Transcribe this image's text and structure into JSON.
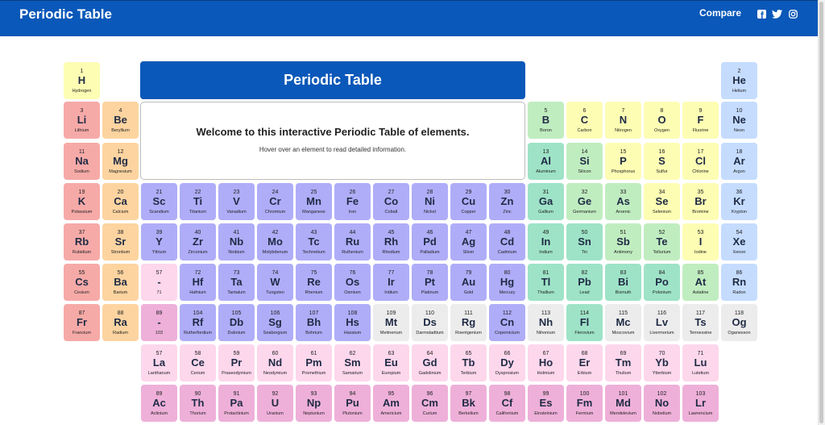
{
  "header": {
    "title": "Periodic Table",
    "compare_label": "Compare",
    "social": [
      "facebook-icon",
      "twitter-icon",
      "instagram-icon"
    ]
  },
  "banner": {
    "title": "Periodic Table"
  },
  "info": {
    "welcome": "Welcome to this interactive Periodic Table of elements.",
    "hint": "Hover over an element to read detailed information."
  },
  "colors": {
    "header_bg": "#0a58b9",
    "alkali": "#f6aaa8",
    "alkaline": "#fdd4a0",
    "transition": "#afadf8",
    "lanthanide": "#fdd7ec",
    "actinide": "#eeb0d9",
    "post_transition": "#9ee3c7",
    "metalloid": "#c0edc0",
    "nonmetal": "#fdfdb4",
    "noble": "#c5dcff",
    "hydrogen": "#fdfdb4",
    "unknown": "#ececec"
  },
  "elements": [
    {
      "n": "1",
      "s": "H",
      "name": "Hydrogen",
      "cat": "hydrogen",
      "r": 0,
      "c": 0
    },
    {
      "n": "2",
      "s": "He",
      "name": "Helium",
      "cat": "noble",
      "r": 0,
      "c": 17
    },
    {
      "n": "3",
      "s": "Li",
      "name": "Lithium",
      "cat": "alkali",
      "r": 1,
      "c": 0
    },
    {
      "n": "4",
      "s": "Be",
      "name": "Beryllium",
      "cat": "alkaline",
      "r": 1,
      "c": 1
    },
    {
      "n": "5",
      "s": "B",
      "name": "Boron",
      "cat": "metalloid",
      "r": 1,
      "c": 12
    },
    {
      "n": "6",
      "s": "C",
      "name": "Carbon",
      "cat": "nonmetal",
      "r": 1,
      "c": 13
    },
    {
      "n": "7",
      "s": "N",
      "name": "Nitrogen",
      "cat": "nonmetal",
      "r": 1,
      "c": 14
    },
    {
      "n": "8",
      "s": "O",
      "name": "Oxygen",
      "cat": "nonmetal",
      "r": 1,
      "c": 15
    },
    {
      "n": "9",
      "s": "F",
      "name": "Fluorine",
      "cat": "nonmetal",
      "r": 1,
      "c": 16
    },
    {
      "n": "10",
      "s": "Ne",
      "name": "Neon",
      "cat": "noble",
      "r": 1,
      "c": 17
    },
    {
      "n": "11",
      "s": "Na",
      "name": "Sodium",
      "cat": "alkali",
      "r": 2,
      "c": 0
    },
    {
      "n": "12",
      "s": "Mg",
      "name": "Magnesium",
      "cat": "alkaline",
      "r": 2,
      "c": 1
    },
    {
      "n": "13",
      "s": "Al",
      "name": "Aluminum",
      "cat": "post_transition",
      "r": 2,
      "c": 12
    },
    {
      "n": "14",
      "s": "Si",
      "name": "Silicon",
      "cat": "metalloid",
      "r": 2,
      "c": 13
    },
    {
      "n": "15",
      "s": "P",
      "name": "Phosphorus",
      "cat": "nonmetal",
      "r": 2,
      "c": 14
    },
    {
      "n": "16",
      "s": "S",
      "name": "Sulfur",
      "cat": "nonmetal",
      "r": 2,
      "c": 15
    },
    {
      "n": "17",
      "s": "Cl",
      "name": "Chlorine",
      "cat": "nonmetal",
      "r": 2,
      "c": 16
    },
    {
      "n": "18",
      "s": "Ar",
      "name": "Argon",
      "cat": "noble",
      "r": 2,
      "c": 17
    },
    {
      "n": "19",
      "s": "K",
      "name": "Potassium",
      "cat": "alkali",
      "r": 3,
      "c": 0
    },
    {
      "n": "20",
      "s": "Ca",
      "name": "Calcium",
      "cat": "alkaline",
      "r": 3,
      "c": 1
    },
    {
      "n": "21",
      "s": "Sc",
      "name": "Scandium",
      "cat": "transition",
      "r": 3,
      "c": 2
    },
    {
      "n": "22",
      "s": "Ti",
      "name": "Titanium",
      "cat": "transition",
      "r": 3,
      "c": 3
    },
    {
      "n": "23",
      "s": "V",
      "name": "Vanadium",
      "cat": "transition",
      "r": 3,
      "c": 4
    },
    {
      "n": "24",
      "s": "Cr",
      "name": "Chromium",
      "cat": "transition",
      "r": 3,
      "c": 5
    },
    {
      "n": "25",
      "s": "Mn",
      "name": "Manganese",
      "cat": "transition",
      "r": 3,
      "c": 6
    },
    {
      "n": "26",
      "s": "Fe",
      "name": "Iron",
      "cat": "transition",
      "r": 3,
      "c": 7
    },
    {
      "n": "27",
      "s": "Co",
      "name": "Cobalt",
      "cat": "transition",
      "r": 3,
      "c": 8
    },
    {
      "n": "28",
      "s": "Ni",
      "name": "Nickel",
      "cat": "transition",
      "r": 3,
      "c": 9
    },
    {
      "n": "29",
      "s": "Cu",
      "name": "Copper",
      "cat": "transition",
      "r": 3,
      "c": 10
    },
    {
      "n": "30",
      "s": "Zn",
      "name": "Zinc",
      "cat": "transition",
      "r": 3,
      "c": 11
    },
    {
      "n": "31",
      "s": "Ga",
      "name": "Gallium",
      "cat": "post_transition",
      "r": 3,
      "c": 12
    },
    {
      "n": "32",
      "s": "Ge",
      "name": "Germanium",
      "cat": "metalloid",
      "r": 3,
      "c": 13
    },
    {
      "n": "33",
      "s": "As",
      "name": "Arsenic",
      "cat": "metalloid",
      "r": 3,
      "c": 14
    },
    {
      "n": "34",
      "s": "Se",
      "name": "Selenium",
      "cat": "nonmetal",
      "r": 3,
      "c": 15
    },
    {
      "n": "35",
      "s": "Br",
      "name": "Bromine",
      "cat": "nonmetal",
      "r": 3,
      "c": 16
    },
    {
      "n": "36",
      "s": "Kr",
      "name": "Krypton",
      "cat": "noble",
      "r": 3,
      "c": 17
    },
    {
      "n": "37",
      "s": "Rb",
      "name": "Rubidium",
      "cat": "alkali",
      "r": 4,
      "c": 0
    },
    {
      "n": "38",
      "s": "Sr",
      "name": "Strontium",
      "cat": "alkaline",
      "r": 4,
      "c": 1
    },
    {
      "n": "39",
      "s": "Y",
      "name": "Yttrium",
      "cat": "transition",
      "r": 4,
      "c": 2
    },
    {
      "n": "40",
      "s": "Zr",
      "name": "Zirconium",
      "cat": "transition",
      "r": 4,
      "c": 3
    },
    {
      "n": "41",
      "s": "Nb",
      "name": "Niobium",
      "cat": "transition",
      "r": 4,
      "c": 4
    },
    {
      "n": "42",
      "s": "Mo",
      "name": "Molybdenum",
      "cat": "transition",
      "r": 4,
      "c": 5
    },
    {
      "n": "43",
      "s": "Tc",
      "name": "Technetium",
      "cat": "transition",
      "r": 4,
      "c": 6
    },
    {
      "n": "44",
      "s": "Ru",
      "name": "Ruthenium",
      "cat": "transition",
      "r": 4,
      "c": 7
    },
    {
      "n": "45",
      "s": "Rh",
      "name": "Rhodium",
      "cat": "transition",
      "r": 4,
      "c": 8
    },
    {
      "n": "46",
      "s": "Pd",
      "name": "Palladium",
      "cat": "transition",
      "r": 4,
      "c": 9
    },
    {
      "n": "47",
      "s": "Ag",
      "name": "Silver",
      "cat": "transition",
      "r": 4,
      "c": 10
    },
    {
      "n": "48",
      "s": "Cd",
      "name": "Cadmium",
      "cat": "transition",
      "r": 4,
      "c": 11
    },
    {
      "n": "49",
      "s": "In",
      "name": "Indium",
      "cat": "post_transition",
      "r": 4,
      "c": 12
    },
    {
      "n": "50",
      "s": "Sn",
      "name": "Tin",
      "cat": "post_transition",
      "r": 4,
      "c": 13
    },
    {
      "n": "51",
      "s": "Sb",
      "name": "Antimony",
      "cat": "metalloid",
      "r": 4,
      "c": 14
    },
    {
      "n": "52",
      "s": "Te",
      "name": "Tellurium",
      "cat": "metalloid",
      "r": 4,
      "c": 15
    },
    {
      "n": "53",
      "s": "I",
      "name": "Iodine",
      "cat": "nonmetal",
      "r": 4,
      "c": 16
    },
    {
      "n": "54",
      "s": "Xe",
      "name": "Xenon",
      "cat": "noble",
      "r": 4,
      "c": 17
    },
    {
      "n": "55",
      "s": "Cs",
      "name": "Cesium",
      "cat": "alkali",
      "r": 5,
      "c": 0
    },
    {
      "n": "56",
      "s": "Ba",
      "name": "Barium",
      "cat": "alkaline",
      "r": 5,
      "c": 1
    },
    {
      "n": "57",
      "s": "-",
      "name": "71",
      "cat": "lanthanide",
      "r": 5,
      "c": 2
    },
    {
      "n": "72",
      "s": "Hf",
      "name": "Hafnium",
      "cat": "transition",
      "r": 5,
      "c": 3
    },
    {
      "n": "73",
      "s": "Ta",
      "name": "Tantalum",
      "cat": "transition",
      "r": 5,
      "c": 4
    },
    {
      "n": "74",
      "s": "W",
      "name": "Tungsten",
      "cat": "transition",
      "r": 5,
      "c": 5
    },
    {
      "n": "75",
      "s": "Re",
      "name": "Rhenium",
      "cat": "transition",
      "r": 5,
      "c": 6
    },
    {
      "n": "76",
      "s": "Os",
      "name": "Osmium",
      "cat": "transition",
      "r": 5,
      "c": 7
    },
    {
      "n": "77",
      "s": "Ir",
      "name": "Iridium",
      "cat": "transition",
      "r": 5,
      "c": 8
    },
    {
      "n": "78",
      "s": "Pt",
      "name": "Platinum",
      "cat": "transition",
      "r": 5,
      "c": 9
    },
    {
      "n": "79",
      "s": "Au",
      "name": "Gold",
      "cat": "transition",
      "r": 5,
      "c": 10
    },
    {
      "n": "80",
      "s": "Hg",
      "name": "Mercury",
      "cat": "transition",
      "r": 5,
      "c": 11
    },
    {
      "n": "81",
      "s": "Tl",
      "name": "Thallium",
      "cat": "post_transition",
      "r": 5,
      "c": 12
    },
    {
      "n": "82",
      "s": "Pb",
      "name": "Lead",
      "cat": "post_transition",
      "r": 5,
      "c": 13
    },
    {
      "n": "83",
      "s": "Bi",
      "name": "Bismuth",
      "cat": "post_transition",
      "r": 5,
      "c": 14
    },
    {
      "n": "84",
      "s": "Po",
      "name": "Polonium",
      "cat": "post_transition",
      "r": 5,
      "c": 15
    },
    {
      "n": "85",
      "s": "At",
      "name": "Astatine",
      "cat": "metalloid",
      "r": 5,
      "c": 16
    },
    {
      "n": "86",
      "s": "Rn",
      "name": "Radon",
      "cat": "noble",
      "r": 5,
      "c": 17
    },
    {
      "n": "87",
      "s": "Fr",
      "name": "Francium",
      "cat": "alkali",
      "r": 6,
      "c": 0
    },
    {
      "n": "88",
      "s": "Ra",
      "name": "Radium",
      "cat": "alkaline",
      "r": 6,
      "c": 1
    },
    {
      "n": "89",
      "s": "-",
      "name": "103",
      "cat": "actinide",
      "r": 6,
      "c": 2
    },
    {
      "n": "104",
      "s": "Rf",
      "name": "Rutherfordium",
      "cat": "transition",
      "r": 6,
      "c": 3
    },
    {
      "n": "105",
      "s": "Db",
      "name": "Dubnium",
      "cat": "transition",
      "r": 6,
      "c": 4
    },
    {
      "n": "106",
      "s": "Sg",
      "name": "Seaborgium",
      "cat": "transition",
      "r": 6,
      "c": 5
    },
    {
      "n": "107",
      "s": "Bh",
      "name": "Bohrium",
      "cat": "transition",
      "r": 6,
      "c": 6
    },
    {
      "n": "108",
      "s": "Hs",
      "name": "Hassium",
      "cat": "transition",
      "r": 6,
      "c": 7
    },
    {
      "n": "109",
      "s": "Mt",
      "name": "Meitnerium",
      "cat": "unknown",
      "r": 6,
      "c": 8
    },
    {
      "n": "110",
      "s": "Ds",
      "name": "Darmstadtium",
      "cat": "unknown",
      "r": 6,
      "c": 9
    },
    {
      "n": "111",
      "s": "Rg",
      "name": "Roentgenium",
      "cat": "unknown",
      "r": 6,
      "c": 10
    },
    {
      "n": "112",
      "s": "Cn",
      "name": "Copernicium",
      "cat": "transition",
      "r": 6,
      "c": 11
    },
    {
      "n": "113",
      "s": "Nh",
      "name": "Nihonium",
      "cat": "unknown",
      "r": 6,
      "c": 12
    },
    {
      "n": "114",
      "s": "Fl",
      "name": "Flerovium",
      "cat": "post_transition",
      "r": 6,
      "c": 13
    },
    {
      "n": "115",
      "s": "Mc",
      "name": "Moscovium",
      "cat": "unknown",
      "r": 6,
      "c": 14
    },
    {
      "n": "116",
      "s": "Lv",
      "name": "Livermorium",
      "cat": "unknown",
      "r": 6,
      "c": 15
    },
    {
      "n": "117",
      "s": "Ts",
      "name": "Tennessine",
      "cat": "unknown",
      "r": 6,
      "c": 16
    },
    {
      "n": "118",
      "s": "Og",
      "name": "Oganesson",
      "cat": "unknown",
      "r": 6,
      "c": 17
    },
    {
      "n": "57",
      "s": "La",
      "name": "Lanthanum",
      "cat": "lanthanide",
      "r": 7,
      "c": 2
    },
    {
      "n": "58",
      "s": "Ce",
      "name": "Cerium",
      "cat": "lanthanide",
      "r": 7,
      "c": 3
    },
    {
      "n": "59",
      "s": "Pr",
      "name": "Praseodymium",
      "cat": "lanthanide",
      "r": 7,
      "c": 4
    },
    {
      "n": "60",
      "s": "Nd",
      "name": "Neodymium",
      "cat": "lanthanide",
      "r": 7,
      "c": 5
    },
    {
      "n": "61",
      "s": "Pm",
      "name": "Promethium",
      "cat": "lanthanide",
      "r": 7,
      "c": 6
    },
    {
      "n": "62",
      "s": "Sm",
      "name": "Samarium",
      "cat": "lanthanide",
      "r": 7,
      "c": 7
    },
    {
      "n": "63",
      "s": "Eu",
      "name": "Europium",
      "cat": "lanthanide",
      "r": 7,
      "c": 8
    },
    {
      "n": "64",
      "s": "Gd",
      "name": "Gadolinium",
      "cat": "lanthanide",
      "r": 7,
      "c": 9
    },
    {
      "n": "65",
      "s": "Tb",
      "name": "Terbium",
      "cat": "lanthanide",
      "r": 7,
      "c": 10
    },
    {
      "n": "66",
      "s": "Dy",
      "name": "Dysprosium",
      "cat": "lanthanide",
      "r": 7,
      "c": 11
    },
    {
      "n": "67",
      "s": "Ho",
      "name": "Holmium",
      "cat": "lanthanide",
      "r": 7,
      "c": 12
    },
    {
      "n": "68",
      "s": "Er",
      "name": "Erbium",
      "cat": "lanthanide",
      "r": 7,
      "c": 13
    },
    {
      "n": "69",
      "s": "Tm",
      "name": "Thulium",
      "cat": "lanthanide",
      "r": 7,
      "c": 14
    },
    {
      "n": "70",
      "s": "Yb",
      "name": "Ytterbium",
      "cat": "lanthanide",
      "r": 7,
      "c": 15
    },
    {
      "n": "71",
      "s": "Lu",
      "name": "Lutetium",
      "cat": "lanthanide",
      "r": 7,
      "c": 16
    },
    {
      "n": "89",
      "s": "Ac",
      "name": "Actinium",
      "cat": "actinide",
      "r": 8,
      "c": 2
    },
    {
      "n": "90",
      "s": "Th",
      "name": "Thorium",
      "cat": "actinide",
      "r": 8,
      "c": 3
    },
    {
      "n": "91",
      "s": "Pa",
      "name": "Protactinium",
      "cat": "actinide",
      "r": 8,
      "c": 4
    },
    {
      "n": "92",
      "s": "U",
      "name": "Uranium",
      "cat": "actinide",
      "r": 8,
      "c": 5
    },
    {
      "n": "93",
      "s": "Np",
      "name": "Neptunium",
      "cat": "actinide",
      "r": 8,
      "c": 6
    },
    {
      "n": "94",
      "s": "Pu",
      "name": "Plutonium",
      "cat": "actinide",
      "r": 8,
      "c": 7
    },
    {
      "n": "95",
      "s": "Am",
      "name": "Americium",
      "cat": "actinide",
      "r": 8,
      "c": 8
    },
    {
      "n": "96",
      "s": "Cm",
      "name": "Curium",
      "cat": "actinide",
      "r": 8,
      "c": 9
    },
    {
      "n": "97",
      "s": "Bk",
      "name": "Berkelium",
      "cat": "actinide",
      "r": 8,
      "c": 10
    },
    {
      "n": "98",
      "s": "Cf",
      "name": "Californium",
      "cat": "actinide",
      "r": 8,
      "c": 11
    },
    {
      "n": "99",
      "s": "Es",
      "name": "Einsteinium",
      "cat": "actinide",
      "r": 8,
      "c": 12
    },
    {
      "n": "100",
      "s": "Fm",
      "name": "Fermium",
      "cat": "actinide",
      "r": 8,
      "c": 13
    },
    {
      "n": "101",
      "s": "Md",
      "name": "Mendelevium",
      "cat": "actinide",
      "r": 8,
      "c": 14
    },
    {
      "n": "102",
      "s": "No",
      "name": "Nobelium",
      "cat": "actinide",
      "r": 8,
      "c": 15
    },
    {
      "n": "103",
      "s": "Lr",
      "name": "Lawrencium",
      "cat": "actinide",
      "r": 8,
      "c": 16
    }
  ]
}
